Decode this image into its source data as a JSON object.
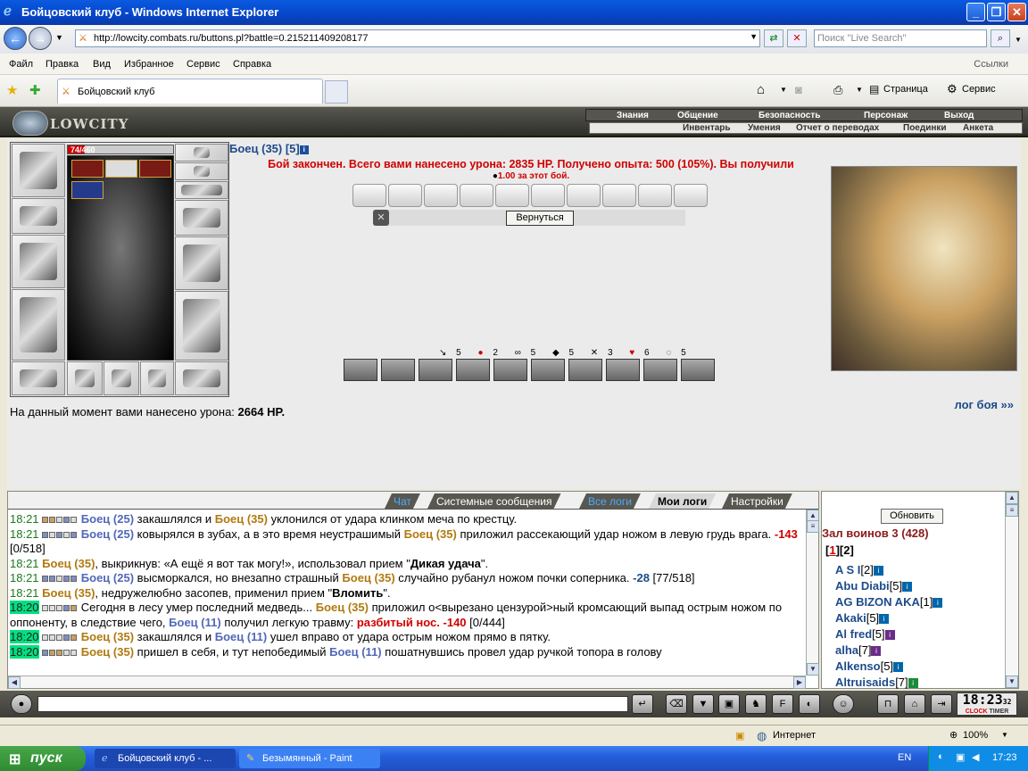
{
  "window": {
    "title": "Бойцовский клуб - Windows Internet Explorer"
  },
  "address": {
    "url": "http://lowcity.combats.ru/buttons.pl?battle=0.215211409208177",
    "search_placeholder": "Поиск \"Live Search\""
  },
  "menu": [
    "Файл",
    "Правка",
    "Вид",
    "Избранное",
    "Сервис",
    "Справка"
  ],
  "links_label": "Ссылки",
  "tab": {
    "title": "Бойцовский клуб"
  },
  "toolbar": {
    "page_label": "Страница",
    "service_label": "Сервис"
  },
  "game": {
    "logo_text": "LOWCITY",
    "topnav": [
      "Знания",
      "Общение",
      "Безопасность",
      "Персонаж",
      "Выход"
    ],
    "subnav": [
      "Инвентарь",
      "Умения",
      "Отчет о переводах",
      "Поединки",
      "Анкета"
    ],
    "hp": {
      "text": "74/460",
      "current": 74,
      "max": 460
    },
    "fighter": {
      "name": "Боец (35) [5]"
    },
    "result_text": "Бой закончен. Всего вами нанесено урона: 2835 HP. Получено опыта: 500 (105%). Вы получили",
    "result_sub": "1.00 за этот бой.",
    "back_button": "Вернуться",
    "stats": [
      "5",
      "2",
      "5",
      "5",
      "3",
      "6",
      "5"
    ],
    "current_damage_label": "На данный момент вами нанесено урона:",
    "current_damage_value": "2664 HP.",
    "log_link": "лог боя »»"
  },
  "chat": {
    "tabs": [
      "Чат",
      "Системные сообщения",
      "Все логи",
      "Мои логи",
      "Настройки"
    ],
    "lines": [
      {
        "t": "18:21",
        "a": "Боец (25)",
        "b": " закашлялся и ",
        "c": "Боец (35)",
        "d": " уклонился от удара клинком меча по крестцу."
      },
      {
        "t": "18:21",
        "a": "Боец (25)",
        "b": " ковырялся в зубах, а в это время неустрашимый ",
        "c": "Боец (35)",
        "d": " приложил рассекающий удар ножом в левую грудь врага. ",
        "e": "-143",
        "f": " [0/518]"
      },
      {
        "t": "18:21",
        "a": "Боец (35)",
        "b": ", выкрикнув: «А ещё я вот так могу!», использовал прием \"",
        "c": "Дикая удача",
        "d": "\"."
      },
      {
        "t": "18:21",
        "a": "Боец (25)",
        "b": " высморкался, но внезапно страшный ",
        "c": "Боец (35)",
        "d": " случайно рубанул ножом почки соперника. ",
        "e": "-28",
        "f": " [77/518]"
      },
      {
        "t": "18:21",
        "a": "Боец (35)",
        "b": ", недружелюбно засопев, применил прием \"",
        "c": "Вломить",
        "d": "\"."
      },
      {
        "t": "18:20",
        "a": "Сегодня в лесу умер последний медведь... ",
        "b": "Боец (35)",
        "c": " приложил о<вырезано цензурой>ный кромсающий выпад острым ножом по оппоненту, в следствие чего, ",
        "d": "Боец (11)",
        "e": " получил легкую травму: ",
        "f": "разбитый нос",
        "g": ". -140",
        "h": " [0/444]"
      },
      {
        "t": "18:20",
        "a": "Боец (35)",
        "b": " закашлялся и ",
        "c": "Боец (11)",
        "d": " ушел вправо от удара острым ножом прямо в пятку."
      },
      {
        "t": "18:20",
        "a": "Боец (35)",
        "b": " пришел в себя, и тут непобедимый ",
        "c": "Боец (11)",
        "d": " пошатнувшись провел удар ручкой топора в голову"
      }
    ]
  },
  "hall": {
    "refresh_button": "Обновить",
    "title": "Зал воинов 3 (428)",
    "pages": [
      "1",
      "2"
    ],
    "players": [
      {
        "name": "A S I",
        "level": "[2]",
        "icon": "blue"
      },
      {
        "name": "Abu Diabi",
        "level": "[5]",
        "icon": "blue"
      },
      {
        "name": "AG BIZON AKA",
        "level": "[1]",
        "icon": "blue"
      },
      {
        "name": "Akaki",
        "level": "[5]",
        "icon": "blue"
      },
      {
        "name": "Al fred",
        "level": "[5]",
        "icon": "purple"
      },
      {
        "name": "alha",
        "level": "[7]",
        "icon": "purple"
      },
      {
        "name": "Alkenso",
        "level": "[5]",
        "icon": "blue"
      },
      {
        "name": "Altruisaids",
        "level": "[7]",
        "icon": "green"
      }
    ]
  },
  "clock": {
    "time": "18:23",
    "sec": "32",
    "label1": "CLOCK",
    "label2": "TIMER"
  },
  "statusbar": {
    "zone": "Интернет",
    "zoom": "100%"
  },
  "taskbar": {
    "start": "пуск",
    "task1": "Бойцовский клуб - ...",
    "task2": "Безымянный - Paint",
    "lang": "EN",
    "time": "17:23"
  }
}
